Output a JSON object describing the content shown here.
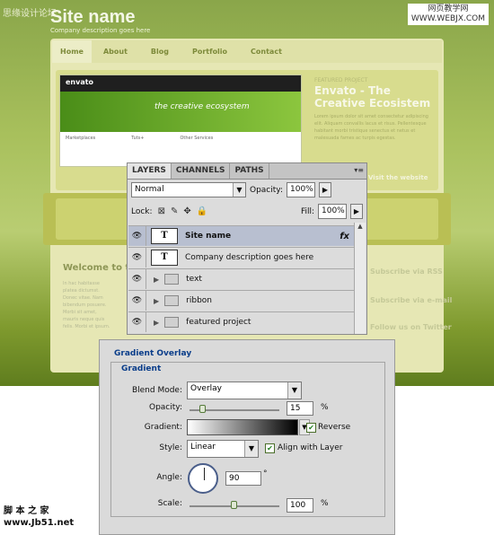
{
  "watermarks": {
    "top_left": "思缘设计论坛",
    "top_right_line1": "网页教学网",
    "top_right_line2": "WWW.WEBJX.COM",
    "bottom_left_line1": "脚 本 之 家",
    "bottom_left_line2": "www.Jb51.net"
  },
  "site": {
    "name": "Site name",
    "description": "Company description goes here",
    "nav": [
      "Home",
      "About",
      "Blog",
      "Portfolio",
      "Contact"
    ],
    "featured": {
      "label": "FEATURED PROJECT",
      "title": "Envato - The Creative Ecosistem",
      "text": "Lorem ipsum dolor sit amet consectetur adipiscing elit. Aliquam convallis lacus et risus. Pellentesque habitant morbi tristique senectus et netus et malesuada fames ac turpis egestas.",
      "visit": "Visit the website",
      "shot_brand": "envato",
      "shot_tagline": "the creative ecosystem",
      "shot_cols": [
        "Marketplaces",
        "Tuts+",
        "Other Services"
      ]
    },
    "welcome": "Welcome to th",
    "body_text": "In hac habitasse platea dictumst. Donec vitae. Nam bibendum posuere. Morbi sit amet, mauris neque quis felis. Morbi et ipsum.",
    "side_links": [
      "Subscribe via RSS",
      "Subscribe via e-mail",
      "Follow us on Twitter"
    ]
  },
  "layers_panel": {
    "tabs": [
      "LAYERS",
      "CHANNELS",
      "PATHS"
    ],
    "blend_mode": "Normal",
    "opacity_label": "Opacity:",
    "opacity_value": "100%",
    "lock_label": "Lock:",
    "fill_label": "Fill:",
    "fill_value": "100%",
    "layers": [
      {
        "name": "Site name",
        "thumb": "T",
        "fx": "fx"
      },
      {
        "name": "Company description goes here",
        "thumb": "T"
      },
      {
        "name": "text"
      },
      {
        "name": "ribbon"
      },
      {
        "name": "featured project"
      }
    ]
  },
  "gradient_overlay": {
    "title": "Gradient Overlay",
    "subtitle": "Gradient",
    "blend_mode_label": "Blend Mode:",
    "blend_mode_value": "Overlay",
    "opacity_label": "Opacity:",
    "opacity_value": "15",
    "opacity_fraction": 0.15,
    "percent": "%",
    "gradient_label": "Gradient:",
    "reverse_label": "Reverse",
    "style_label": "Style:",
    "style_value": "Linear",
    "align_label": "Align with Layer",
    "angle_label": "Angle:",
    "angle_value": "90",
    "degree": "°",
    "scale_label": "Scale:",
    "scale_value": "100",
    "scale_fraction": 0.5
  }
}
